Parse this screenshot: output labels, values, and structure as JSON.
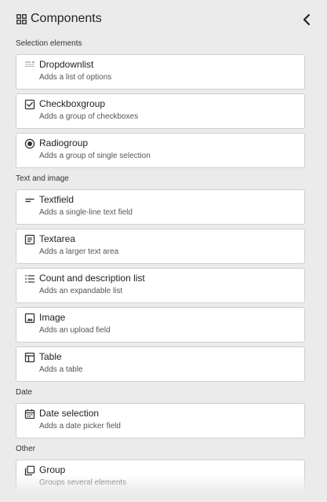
{
  "header": {
    "title": "Components",
    "title_icon": "grid-icon",
    "collapse_icon": "chevron-left-icon"
  },
  "sections": [
    {
      "title": "Selection elements",
      "items": [
        {
          "label": "Dropdownlist",
          "description": "Adds a list of options",
          "icon": "dropdown-list-icon"
        },
        {
          "label": "Checkboxgroup",
          "description": "Adds a group of checkboxes",
          "icon": "checkbox-icon"
        },
        {
          "label": "Radiogroup",
          "description": "Adds a group of single selection",
          "icon": "radio-icon"
        }
      ]
    },
    {
      "title": "Text and image",
      "items": [
        {
          "label": "Textfield",
          "description": "Adds a single-line text field",
          "icon": "textfield-icon"
        },
        {
          "label": "Textarea",
          "description": "Adds a larger text area",
          "icon": "textarea-icon"
        },
        {
          "label": "Count and description list",
          "description": "Adds an expandable list",
          "icon": "list-icon"
        },
        {
          "label": "Image",
          "description": "Adds an upload field",
          "icon": "image-icon"
        },
        {
          "label": "Table",
          "description": "Adds a table",
          "icon": "table-icon"
        }
      ]
    },
    {
      "title": "Date",
      "items": [
        {
          "label": "Date selection",
          "description": "Adds a date picker field",
          "icon": "calendar-icon"
        }
      ]
    },
    {
      "title": "Other",
      "items": [
        {
          "label": "Group",
          "description": "Groups several elements",
          "icon": "group-icon"
        }
      ]
    }
  ]
}
